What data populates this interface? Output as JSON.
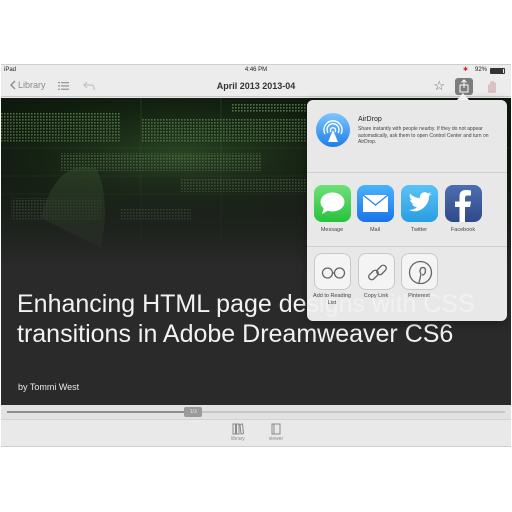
{
  "status_bar": {
    "device": "iPad",
    "time": "4:46 PM",
    "battery": "92%",
    "battery_level": 0.92
  },
  "nav": {
    "back_label": "Library",
    "title": "April 2013 2013-04"
  },
  "article": {
    "headline": "Enhancing HTML page designs with CSS transitions in Adobe Dreamweaver CS6",
    "byline": "by Tommi West"
  },
  "scrubber": {
    "page_label": "1/3",
    "progress": 0.36
  },
  "toolbar": {
    "items": [
      {
        "label": "library"
      },
      {
        "label": "viewer"
      }
    ]
  },
  "share_sheet": {
    "airdrop": {
      "title": "AirDrop",
      "description": "Share instantly with people nearby. If they do not appear automatically, ask them to open Control Center and turn on AirDrop."
    },
    "apps": [
      {
        "label": "Message",
        "icon": "message-icon",
        "color": "#4cd964"
      },
      {
        "label": "Mail",
        "icon": "mail-icon",
        "color": "#1a8cf2"
      },
      {
        "label": "Twitter",
        "icon": "twitter-icon",
        "color": "#1da1f2"
      },
      {
        "label": "Facebook",
        "icon": "facebook-icon",
        "color": "#3b5998"
      }
    ],
    "actions": [
      {
        "label": "Add to Reading List",
        "icon": "reading-list-icon"
      },
      {
        "label": "Copy Link",
        "icon": "copy-link-icon"
      },
      {
        "label": "Pinterest",
        "icon": "pinterest-icon"
      }
    ]
  }
}
